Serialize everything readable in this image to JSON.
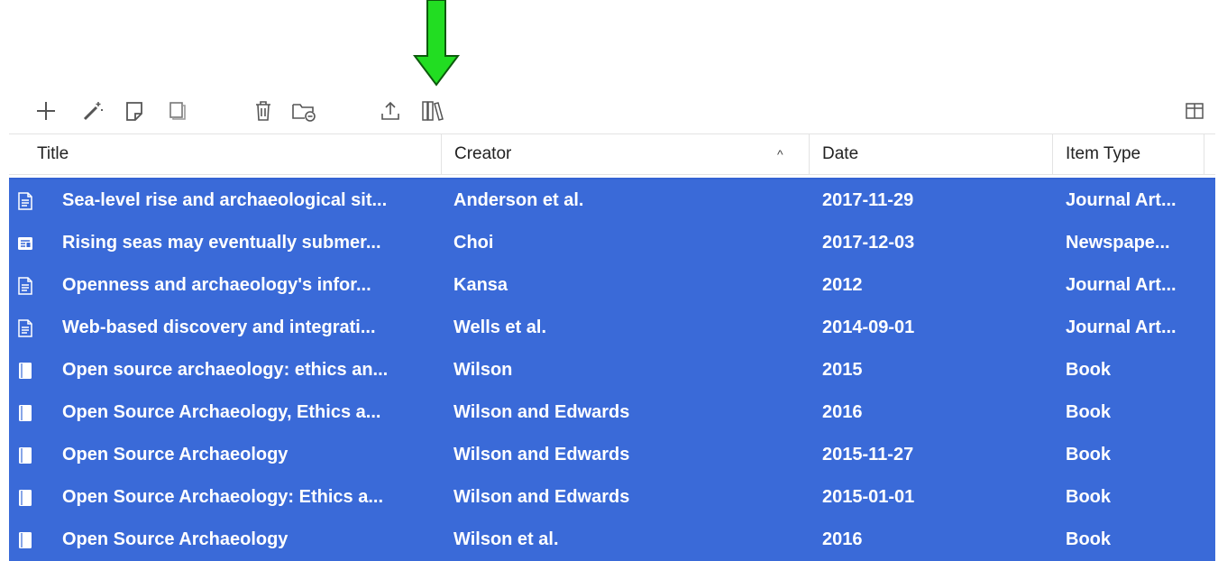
{
  "colors": {
    "selection": "#3a6ad8",
    "annotation_arrow": "#22dd22",
    "icon_stroke": "#555555"
  },
  "toolbar": {
    "buttons": [
      {
        "name": "new-item",
        "icon": "plus-icon"
      },
      {
        "name": "add-by-identifier",
        "icon": "magic-wand-icon"
      },
      {
        "name": "new-note",
        "icon": "note-icon"
      },
      {
        "name": "attachment",
        "icon": "paperclip-page-icon"
      },
      {
        "name": "move-to-trash",
        "icon": "trash-icon"
      },
      {
        "name": "remove-from-collection",
        "icon": "folder-minus-icon"
      },
      {
        "name": "export",
        "icon": "upload-icon"
      },
      {
        "name": "library-lookup",
        "icon": "library-books-icon"
      },
      {
        "name": "column-picker",
        "icon": "columns-icon"
      }
    ]
  },
  "columns": {
    "title": "Title",
    "creator": "Creator",
    "date": "Date",
    "item_type": "Item Type",
    "sort_indicator": "^"
  },
  "items": [
    {
      "icon": "journal-article-icon",
      "title": "Sea-level rise and archaeological sit...",
      "creator": "Anderson et al.",
      "date": "2017-11-29",
      "item_type": "Journal Art..."
    },
    {
      "icon": "newspaper-icon",
      "title": "Rising seas may eventually submer...",
      "creator": "Choi",
      "date": "2017-12-03",
      "item_type": "Newspape..."
    },
    {
      "icon": "journal-article-icon",
      "title": "Openness and archaeology's infor...",
      "creator": "Kansa",
      "date": "2012",
      "item_type": "Journal Art..."
    },
    {
      "icon": "journal-article-icon",
      "title": "Web-based discovery and integrati...",
      "creator": "Wells et al.",
      "date": "2014-09-01",
      "item_type": "Journal Art..."
    },
    {
      "icon": "book-icon",
      "title": "Open source archaeology: ethics an...",
      "creator": "Wilson",
      "date": "2015",
      "item_type": "Book"
    },
    {
      "icon": "book-icon",
      "title": "Open Source Archaeology, Ethics a...",
      "creator": "Wilson and Edwards",
      "date": "2016",
      "item_type": "Book"
    },
    {
      "icon": "book-icon",
      "title": "Open Source Archaeology",
      "creator": "Wilson and Edwards",
      "date": "2015-11-27",
      "item_type": "Book"
    },
    {
      "icon": "book-icon",
      "title": "Open Source Archaeology: Ethics a...",
      "creator": "Wilson and Edwards",
      "date": "2015-01-01",
      "item_type": "Book"
    },
    {
      "icon": "book-icon",
      "title": "Open Source Archaeology",
      "creator": "Wilson et al.",
      "date": "2016",
      "item_type": "Book"
    }
  ]
}
